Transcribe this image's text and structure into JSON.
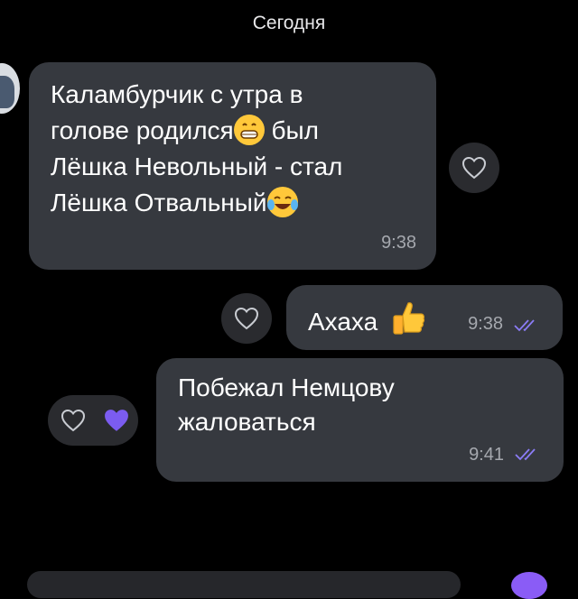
{
  "date_header": "Сегодня",
  "colors": {
    "background": "#000000",
    "bubble": "#36393f",
    "accent_purple": "#7b5cf0",
    "heart_button_bg": "#2a2b2f"
  },
  "messages": [
    {
      "direction": "incoming",
      "lines": [
        "Каламбурчик с утра в",
        "голове родился",
        "был",
        "Лёшка Невольный - стал",
        "Лёшка Отвальный"
      ],
      "emojis": [
        "grinning-face-emoji",
        "tears-of-joy-emoji"
      ],
      "time": "9:38"
    },
    {
      "direction": "outgoing",
      "text": "Ахаха",
      "emoji": "thumbs-up-emoji",
      "time": "9:38",
      "status": "read"
    },
    {
      "direction": "outgoing",
      "lines": [
        "Побежал Немцову",
        "жаловаться"
      ],
      "time": "9:41",
      "status": "read",
      "reaction": "purple-heart"
    }
  ]
}
